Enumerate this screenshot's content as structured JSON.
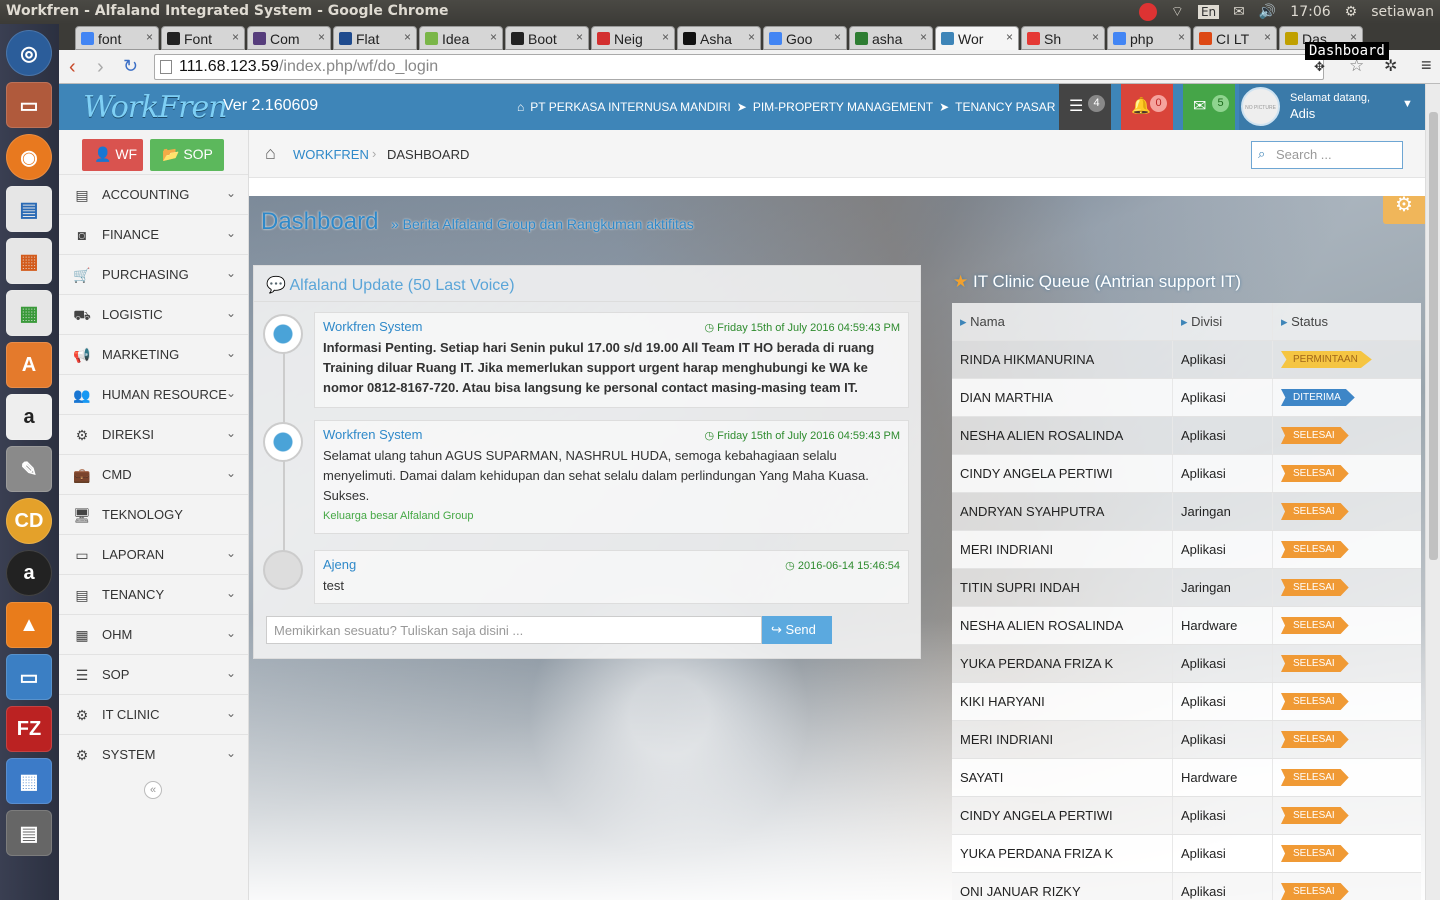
{
  "os": {
    "window_title": "Workfren - Alfaland Integrated System - Google Chrome",
    "tray": {
      "lang": "En",
      "clock": "17:06",
      "user": "setiawan"
    }
  },
  "browser": {
    "tabs": [
      {
        "label": "font",
        "color": "#4285f4"
      },
      {
        "label": "Font",
        "color": "#222"
      },
      {
        "label": "Com",
        "color": "#563d7c"
      },
      {
        "label": "Flat",
        "color": "#1f4b8e"
      },
      {
        "label": "Idea",
        "color": "#7ab648"
      },
      {
        "label": "Boot",
        "color": "#222"
      },
      {
        "label": "Neig",
        "color": "#d32f2f"
      },
      {
        "label": "Asha",
        "color": "#111"
      },
      {
        "label": "Goo",
        "color": "#4285f4"
      },
      {
        "label": "asha",
        "color": "#2e7d32"
      },
      {
        "label": "Wor",
        "color": "#3e85b8"
      },
      {
        "label": "Sh",
        "color": "#e53935"
      },
      {
        "label": "php",
        "color": "#4285f4"
      },
      {
        "label": "CI LT",
        "color": "#dd4814"
      },
      {
        "label": "Das",
        "color": "#c0a000"
      }
    ],
    "tooltip": "Dashboard",
    "url_host": "111.68.123.59",
    "url_path": "/index.php/wf/do_login"
  },
  "header": {
    "logo": "WorkFren",
    "version": "Ver 2.160609",
    "breadcrumbs": [
      "PT PERKASA INTERNUSA MANDIRI",
      "PIM-PROPERTY MANAGEMENT",
      "TENANCY PASAR MINGGU"
    ],
    "tasks_count": "4",
    "notif_count": "0",
    "mail_count": "5",
    "greeting": "Selamat datang,",
    "username": "Adis",
    "no_picture": "NO PICTURE",
    "colors": {
      "tasks": "#888",
      "notif": "#e8534a",
      "mail": "#57b75a"
    }
  },
  "sidebar": {
    "wf_label": "WF",
    "sop_label": "SOP",
    "items": [
      {
        "label": "ACCOUNTING",
        "icon": "book-icon",
        "glyph": "▤"
      },
      {
        "label": "FINANCE",
        "icon": "money-icon",
        "glyph": "◙"
      },
      {
        "label": "PURCHASING",
        "icon": "cart-icon",
        "glyph": "🛒"
      },
      {
        "label": "LOGISTIC",
        "icon": "truck-icon",
        "glyph": "⛟"
      },
      {
        "label": "MARKETING",
        "icon": "bullhorn-icon",
        "glyph": "📢"
      },
      {
        "label": "HUMAN RESOURCE",
        "icon": "users-icon",
        "glyph": "👥"
      },
      {
        "label": "DIREKSI",
        "icon": "gear-icon",
        "glyph": "⚙"
      },
      {
        "label": "CMD",
        "icon": "briefcase-icon",
        "glyph": "💼"
      },
      {
        "label": "TEKNOLOGY",
        "icon": "monitor-icon",
        "glyph": "🖥"
      },
      {
        "label": "LAPORAN",
        "icon": "card-icon",
        "glyph": "▭"
      },
      {
        "label": "TENANCY",
        "icon": "book-icon",
        "glyph": "▤"
      },
      {
        "label": "OHM",
        "icon": "building-icon",
        "glyph": "▦"
      },
      {
        "label": "SOP",
        "icon": "list-icon",
        "glyph": "☰"
      },
      {
        "label": "IT CLINIC",
        "icon": "gear-icon",
        "glyph": "⚙"
      },
      {
        "label": "SYSTEM",
        "icon": "gears-icon",
        "glyph": "⚙"
      }
    ]
  },
  "crumbbar": {
    "home": "WORKFREN",
    "current": "DASHBOARD",
    "search_placeholder": "Search ..."
  },
  "dashboard": {
    "title": "Dashboard",
    "subtitle": "» Berita Alfaland Group dan Rangkuman aktifitas",
    "feed_title": "Alfaland Update (50 Last Voice)",
    "posts": [
      {
        "author": "Workfren System",
        "time": "Friday 15th of July 2016 04:59:43 PM",
        "text": "Informasi Penting. Setiap hari Senin pukul 17.00 s/d 19.00 All Team IT HO berada di ruang Training diluar Ruang IT. Jika memerlukan support urgent harap menghubungi ke WA ke nomor 0812-8167-720. Atau bisa langsung ke personal contact masing-masing team IT."
      },
      {
        "author": "Workfren System",
        "time": "Friday 15th of July 2016 04:59:43 PM",
        "text": "Selamat ulang tahun AGUS SUPARMAN, NASHRUL HUDA, semoga kebahagiaan selalu menyelimuti. Damai dalam kehidupan dan sehat selalu dalam perlindungan Yang Maha Kuasa. Sukses.",
        "signature": "Keluarga besar Alfaland Group"
      },
      {
        "author": "Ajeng",
        "time": "2016-06-14 15:46:54",
        "text": "test"
      }
    ],
    "input_placeholder": "Memikirkan sesuatu? Tuliskan saja disini ...",
    "send_label": "Send",
    "queue_title": "IT Clinic Queue (Antrian support IT)",
    "queue_headers": [
      "Nama",
      "Divisi",
      "Status"
    ],
    "status_colors": {
      "PERMINTAAN": "#f5c542",
      "DITERIMA": "#3e86c7",
      "SELESAI": "#f09a35"
    },
    "queue": [
      [
        "RINDA HIKMANURINA",
        "Aplikasi",
        "PERMINTAAN"
      ],
      [
        "DIAN MARTHIA",
        "Aplikasi",
        "DITERIMA"
      ],
      [
        "NESHA ALIEN ROSALINDA",
        "Aplikasi",
        "SELESAI"
      ],
      [
        "CINDY ANGELA PERTIWI",
        "Aplikasi",
        "SELESAI"
      ],
      [
        "ANDRYAN SYAHPUTRA",
        "Jaringan",
        "SELESAI"
      ],
      [
        "MERI INDRIANI",
        "Aplikasi",
        "SELESAI"
      ],
      [
        "TITIN SUPRI INDAH",
        "Jaringan",
        "SELESAI"
      ],
      [
        "NESHA ALIEN ROSALINDA",
        "Hardware",
        "SELESAI"
      ],
      [
        "YUKA PERDANA FRIZA K",
        "Aplikasi",
        "SELESAI"
      ],
      [
        "KIKI HARYANI",
        "Aplikasi",
        "SELESAI"
      ],
      [
        "MERI INDRIANI",
        "Aplikasi",
        "SELESAI"
      ],
      [
        "SAYATI",
        "Hardware",
        "SELESAI"
      ],
      [
        "CINDY ANGELA PERTIWI",
        "Aplikasi",
        "SELESAI"
      ],
      [
        "YUKA PERDANA FRIZA K",
        "Aplikasi",
        "SELESAI"
      ],
      [
        "ONI JANUAR RIZKY",
        "Aplikasi",
        "SELESAI"
      ]
    ]
  }
}
